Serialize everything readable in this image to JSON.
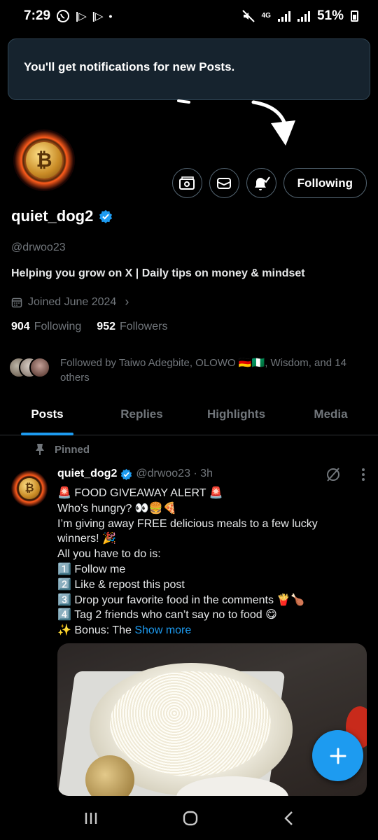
{
  "status_bar": {
    "time": "7:29",
    "network": "4G",
    "battery": "51%",
    "icons": [
      "whatsapp-icon",
      "media-icon",
      "media-icon",
      "dot",
      "mute-icon",
      "signal-icon",
      "battery-icon"
    ]
  },
  "toast": {
    "message": "You'll get notifications for new Posts."
  },
  "profile": {
    "display_name": "quiet_dog2",
    "handle": "@drwoo23",
    "bio": "Helping you grow on X | Daily tips on money & mindset",
    "joined": "Joined June 2024",
    "following_count": "904",
    "following_label": "Following",
    "followers_count": "952",
    "followers_label": "Followers",
    "followed_by": "Followed by Taiwo Adegbite, OLOWO 🇩🇪🇳🇬, Wisdom, and 14 others",
    "following_button": "Following"
  },
  "tabs": [
    {
      "label": "Posts",
      "active": true
    },
    {
      "label": "Replies",
      "active": false
    },
    {
      "label": "Highlights",
      "active": false
    },
    {
      "label": "Media",
      "active": false
    }
  ],
  "post": {
    "pinned_label": "Pinned",
    "author_name": "quiet_dog2",
    "author_meta": "@drwoo23 · 3h",
    "lines": [
      "🚨 FOOD GIVEAWAY ALERT 🚨",
      "Who’s hungry? 👀🍔🍕",
      "I’m giving away FREE delicious meals to a few lucky winners! 🎉",
      "All you have to do is:",
      "1️⃣ Follow me",
      "2️⃣ Like & repost this post",
      "3️⃣ Drop your favorite food in the comments 🍟🍗",
      "4️⃣ Tag 2 friends who can’t say no to food 😋"
    ],
    "bonus_prefix": "✨ Bonus: The",
    "show_more": "Show more"
  },
  "colors": {
    "accent": "#1d9bf0",
    "background": "#000000",
    "muted_text": "#71767b",
    "toast_bg": "#16232e"
  }
}
